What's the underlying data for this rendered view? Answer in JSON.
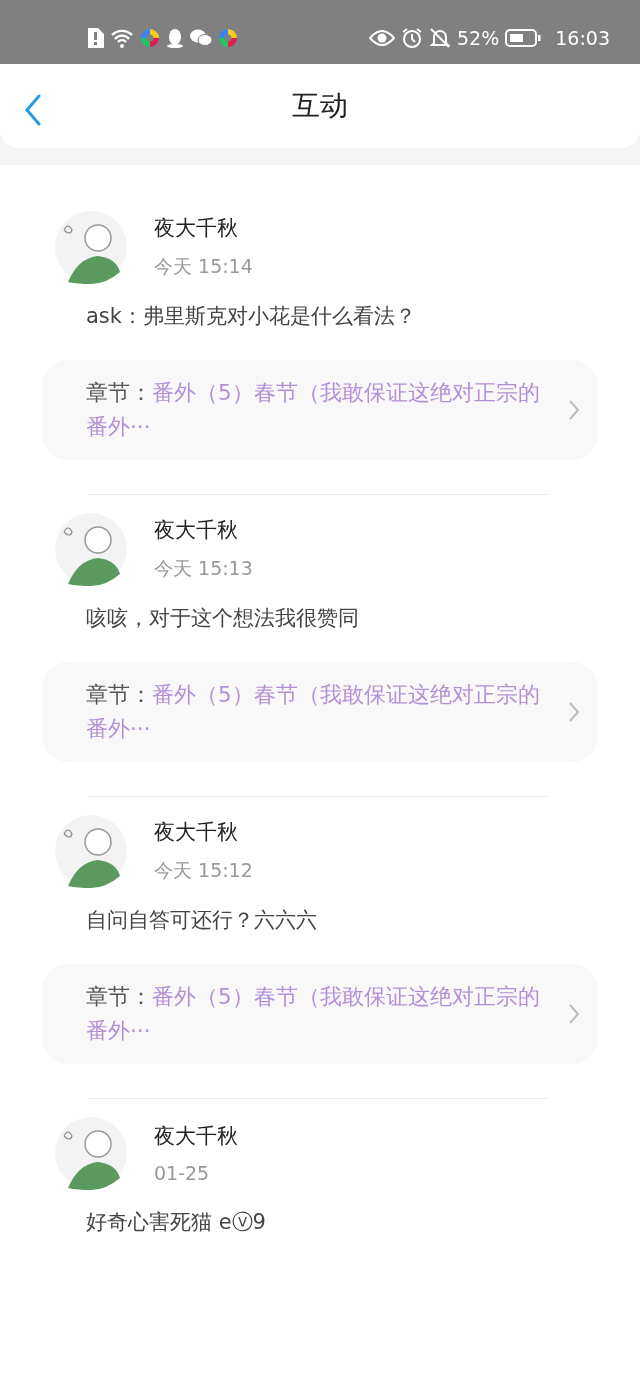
{
  "status_bar": {
    "battery_text": "52%",
    "time": "16:03"
  },
  "header": {
    "title": "互动"
  },
  "comments": [
    {
      "user": "夜大千秋",
      "time": "今天 15:14",
      "text": "ask：弗里斯克对小花是什么看法？",
      "chapter": {
        "label": "章节：",
        "title": "番外（5）春节（我敢保证这绝对正宗的番外···"
      }
    },
    {
      "user": "夜大千秋",
      "time": "今天 15:13",
      "text": "咳咳，对于这个想法我很赞同",
      "chapter": {
        "label": "章节：",
        "title": "番外（5）春节（我敢保证这绝对正宗的番外···"
      }
    },
    {
      "user": "夜大千秋",
      "time": "今天 15:12",
      "text": "自问自答可还行？六六六",
      "chapter": {
        "label": "章节：",
        "title": "番外（5）春节（我敢保证这绝对正宗的番外···"
      }
    },
    {
      "user": "夜大千秋",
      "time": "01-25",
      "text": "好奇心害死猫 eⓥ9"
    }
  ]
}
